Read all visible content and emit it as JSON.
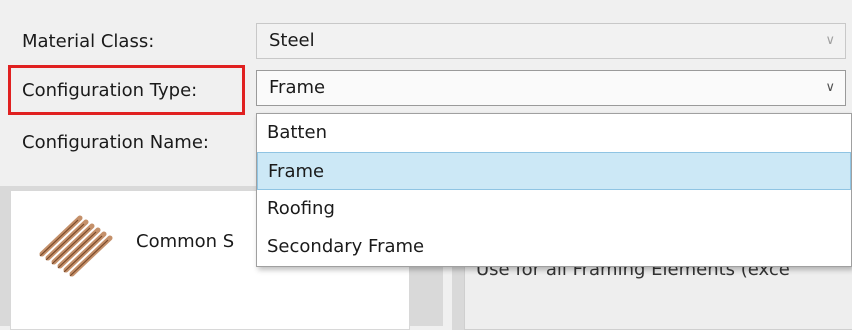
{
  "material_class": {
    "label": "Material Class:",
    "value": "Steel",
    "chevron": "∨"
  },
  "configuration_type": {
    "label": "Configuration Type:",
    "value": "Frame",
    "chevron": "∨"
  },
  "configuration_name": {
    "label": "Configuration Name:"
  },
  "dropdown": {
    "options": [
      "Batten",
      "Frame",
      "Roofing",
      "Secondary Frame"
    ],
    "selected": "Frame"
  },
  "card": {
    "title": "Common S",
    "icon": "timber-frame-icon"
  },
  "description": {
    "text": "Use for all Framing Elements (exce"
  },
  "colors": {
    "highlight": "#e02020",
    "selection": "#cce8f6"
  }
}
